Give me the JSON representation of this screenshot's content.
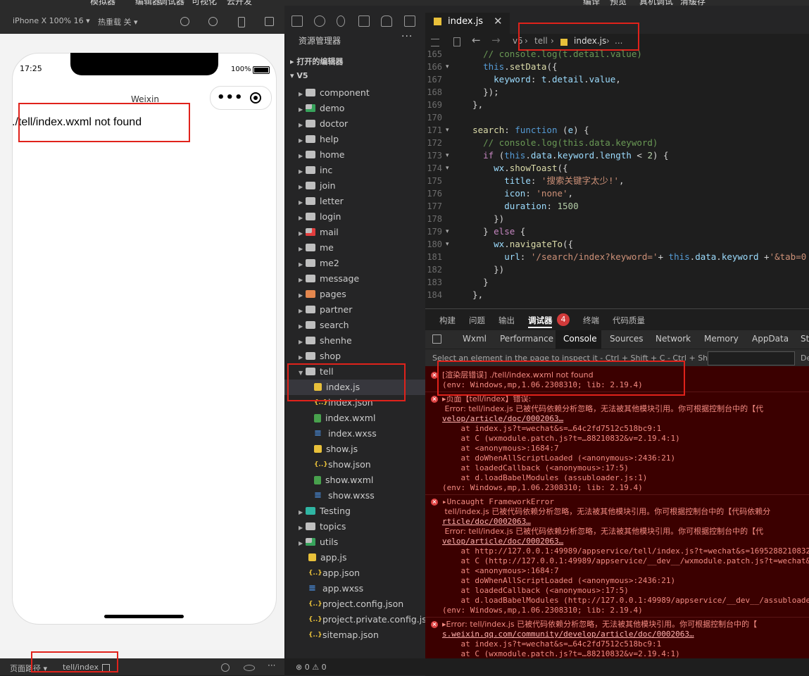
{
  "top_menu": [
    "模拟器",
    "编辑器",
    "调试器",
    "可视化",
    "云开发",
    "编译",
    "预览",
    "真机调试",
    "清缓存"
  ],
  "simulator": {
    "device": "iPhone X 100% 16 ▾",
    "hotreload": "热重载 关 ▾",
    "time": "17:25",
    "battery": "100%",
    "nav_title": "Weixin",
    "capsule_dots": "•••",
    "error_text": "./tell/index.wxml not found",
    "footer_path_label": "页面路径 ▾",
    "footer_path": "tell/index"
  },
  "explorer": {
    "title": "资源管理器",
    "more": "···",
    "open_editors": "打开的编辑器",
    "root": "V5",
    "items": [
      {
        "name": "component",
        "type": "folder"
      },
      {
        "name": "demo",
        "type": "folder-green"
      },
      {
        "name": "doctor",
        "type": "folder"
      },
      {
        "name": "help",
        "type": "folder"
      },
      {
        "name": "home",
        "type": "folder"
      },
      {
        "name": "inc",
        "type": "folder"
      },
      {
        "name": "join",
        "type": "folder"
      },
      {
        "name": "letter",
        "type": "folder"
      },
      {
        "name": "login",
        "type": "folder"
      },
      {
        "name": "mail",
        "type": "folder-red"
      },
      {
        "name": "me",
        "type": "folder"
      },
      {
        "name": "me2",
        "type": "folder"
      },
      {
        "name": "message",
        "type": "folder"
      },
      {
        "name": "pages",
        "type": "folder-orange"
      },
      {
        "name": "partner",
        "type": "folder"
      },
      {
        "name": "search",
        "type": "folder"
      },
      {
        "name": "shenhe",
        "type": "folder"
      },
      {
        "name": "shop",
        "type": "folder"
      },
      {
        "name": "tell",
        "type": "folder-open"
      },
      {
        "name": "index.js",
        "type": "js",
        "child": true,
        "selected": true
      },
      {
        "name": "index.json",
        "type": "json",
        "child": true
      },
      {
        "name": "index.wxml",
        "type": "wxml",
        "child": true
      },
      {
        "name": "index.wxss",
        "type": "wxss",
        "child": true
      },
      {
        "name": "show.js",
        "type": "js",
        "child": true
      },
      {
        "name": "show.json",
        "type": "json",
        "child": true
      },
      {
        "name": "show.wxml",
        "type": "wxml",
        "child": true
      },
      {
        "name": "show.wxss",
        "type": "wxss",
        "child": true
      },
      {
        "name": "Testing",
        "type": "folder-teal"
      },
      {
        "name": "topics",
        "type": "folder"
      },
      {
        "name": "utils",
        "type": "folder-green"
      },
      {
        "name": "app.js",
        "type": "js",
        "file": true
      },
      {
        "name": "app.json",
        "type": "json",
        "file": true
      },
      {
        "name": "app.wxss",
        "type": "wxss",
        "file": true
      },
      {
        "name": "project.config.json",
        "type": "json",
        "file": true
      },
      {
        "name": "project.private.config.js...",
        "type": "json",
        "file": true
      },
      {
        "name": "sitemap.json",
        "type": "json",
        "file": true
      }
    ],
    "status": "⊗ 0 ⚠ 0"
  },
  "editor": {
    "tab": "index.js",
    "close": "✕",
    "breadcrumb": [
      "v5",
      "›",
      "tell",
      "›",
      "index.js",
      "›",
      "..."
    ],
    "line_numbers": [
      "165",
      "166",
      "167",
      "168",
      "169",
      "170",
      "171",
      "172",
      "173",
      "174",
      "175",
      "176",
      "177",
      "178",
      "179",
      "180",
      "181",
      "182",
      "183",
      "184"
    ]
  },
  "panel": {
    "tabs": [
      "构建",
      "问题",
      "输出",
      "调试器",
      "终端",
      "代码质量"
    ],
    "badge": "4",
    "devtools_tabs": [
      "Wxml",
      "Performance",
      "Console",
      "Sources",
      "Network",
      "Memory",
      "AppData",
      "St"
    ],
    "filter_hint": "Select an element in the page to inspect it - Ctrl + Shift + C - Ctrl + Shift + C",
    "filter_de": "De",
    "console_lines": [
      "[渲染层错误] ./tell/index.wxml not found",
      "(env: Windows,mp,1.06.2308310; lib: 2.19.4)",
      "▸页面【tell/index】错误:",
      " Error: tell/index.js 已被代码依赖分析忽略，无法被其他模块引用。你可根据控制台中的【代",
      "velop/article/doc/0002063…",
      "    at index.js?t=wechat&s=…64c2fd7512c518bc9:1",
      "    at C (wxmodule.patch.js?t=…88210832&v=2.19.4:1)",
      "    at <anonymous>:1684:7",
      "    at doWhenAllScriptLoaded (<anonymous>:2436:21)",
      "    at loadedCallback (<anonymous>:17:5)",
      "    at d.loadBabelModules (assubloader.js:1)",
      "(env: Windows,mp,1.06.2308310; lib: 2.19.4)",
      "▸Uncaught FrameworkError",
      " tell/index.js 已被代码依赖分析忽略，无法被其他模块引用。你可根据控制台中的【代码依赖分",
      "rticle/doc/0002063…",
      " Error: tell/index.js 已被代码依赖分析忽略，无法被其他模块引用。你可根据控制台中的【代",
      "velop/article/doc/0002063…",
      "    at http://127.0.0.1:49989/appservice/tell/index.js?t=wechat&s=16952882108320",
      "    at C (http://127.0.0.1:49989/appservice/__dev__/wxmodule.patch.js?t=wechat&",
      "    at <anonymous>:1684:7",
      "    at doWhenAllScriptLoaded (<anonymous>:2436:21)",
      "    at loadedCallback (<anonymous>:17:5)",
      "    at d.loadBabelModules (http://127.0.0.1:49989/appservice/__dev__/assubloade",
      "(env: Windows,mp,1.06.2308310; lib: 2.19.4)",
      "▸Error: tell/index.js 已被代码依赖分析忽略，无法被其他模块引用。你可根据控制台中的【",
      "s.weixin.qq.com/community/develop/article/doc/0002063…",
      "    at index.js?t=wechat&s=…64c2fd7512c518bc9:1",
      "    at C (wxmodule.patch.js?t=…88210832&v=2.19.4:1)"
    ]
  }
}
